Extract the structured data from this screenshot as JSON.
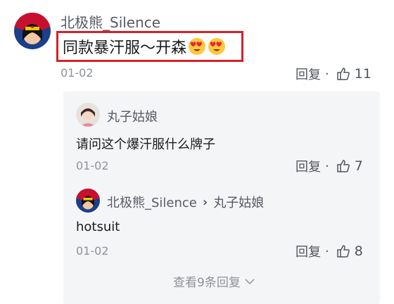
{
  "comment": {
    "author": "北极熊_Silence",
    "text": "同款暴汗服～开森",
    "emojis": [
      "heart-eyes-emoji",
      "heart-eyes-emoji"
    ],
    "date": "01-02",
    "reply_label": "回复",
    "separator": "·",
    "like_count": "11"
  },
  "replies": [
    {
      "author": "丸子姑娘",
      "text": "请问这个爆汗服什么牌子",
      "date": "01-02",
      "reply_label": "回复",
      "separator": "·",
      "like_count": "7"
    },
    {
      "author": "北极熊_Silence",
      "reply_to_arrow": "›",
      "reply_to": "丸子姑娘",
      "text": "hotsuit",
      "date": "01-02",
      "reply_label": "回复",
      "separator": "·",
      "like_count": "8"
    }
  ],
  "more_replies_label": "查看9条回复",
  "colors": {
    "highlight_border": "#d6202a",
    "reply_panel_bg": "#f4f5f6",
    "secondary_text": "#8e9299"
  }
}
